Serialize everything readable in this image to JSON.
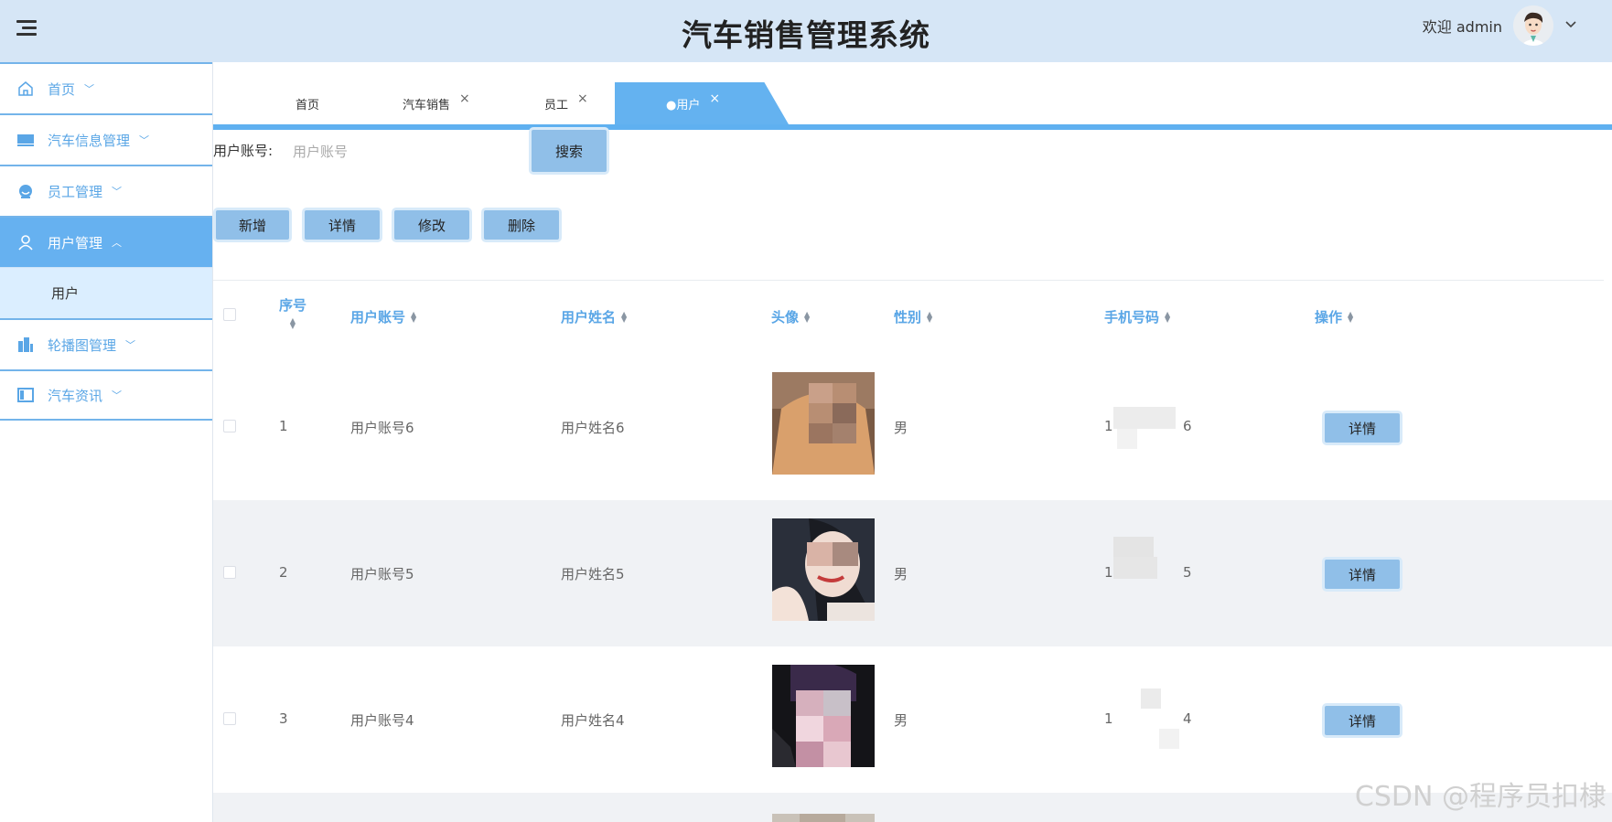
{
  "header": {
    "app_title": "汽车销售管理系统",
    "welcome_text": "欢迎 admin",
    "user_avatar": "avatar-icon",
    "dropdown_icon": "chevron-down-icon",
    "menu_icon": "hamburger-icon"
  },
  "sidebar": {
    "items": [
      {
        "label": "首页",
        "icon": "home-icon"
      },
      {
        "label": "汽车信息管理",
        "icon": "monitor-icon"
      },
      {
        "label": "员工管理",
        "icon": "employee-icon"
      },
      {
        "label": "用户管理",
        "icon": "user-icon",
        "active": true
      },
      {
        "label": "轮播图管理",
        "icon": "building-icon"
      },
      {
        "label": "汽车资讯",
        "icon": "news-icon"
      }
    ],
    "sub_item": "用户"
  },
  "tabs": [
    {
      "label": "首页",
      "closable": false
    },
    {
      "label": "汽车销售",
      "closable": true
    },
    {
      "label": "员工",
      "closable": true
    },
    {
      "label": "●用户",
      "closable": true,
      "active": true
    }
  ],
  "tab_close_glyph": "×",
  "search": {
    "label": "用户账号:",
    "placeholder": "用户账号",
    "button": "搜索"
  },
  "actions": {
    "add": "新增",
    "detail": "详情",
    "edit": "修改",
    "delete": "删除"
  },
  "table": {
    "columns": [
      "序号",
      "用户账号",
      "用户姓名",
      "头像",
      "性别",
      "手机号码",
      "操作"
    ],
    "rows": [
      {
        "index": "1",
        "account": "用户账号6",
        "name": "用户姓名6",
        "gender": "男",
        "phone_first": "1",
        "phone_last": "6",
        "action": "详情"
      },
      {
        "index": "2",
        "account": "用户账号5",
        "name": "用户姓名5",
        "gender": "男",
        "phone_first": "1",
        "phone_last": "5",
        "action": "详情"
      },
      {
        "index": "3",
        "account": "用户账号4",
        "name": "用户姓名4",
        "gender": "男",
        "phone_first": "1",
        "phone_last": "4",
        "action": "详情"
      }
    ]
  },
  "watermark": "CSDN @程序员扣棣",
  "colors": {
    "header_bg": "#d6e6f6",
    "accent": "#5fb0f0",
    "button": "#90bfe8",
    "active_nav": "#66b1f0"
  }
}
